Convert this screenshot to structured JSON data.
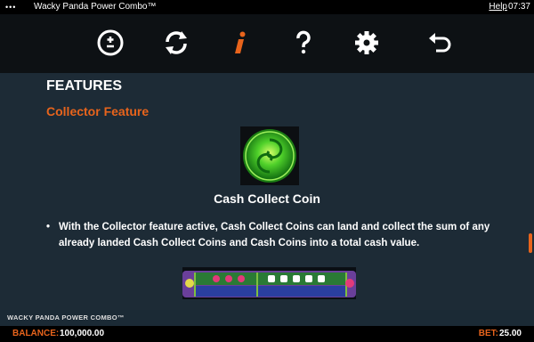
{
  "titlebar": {
    "dots": "•••",
    "title": "Wacky Panda Power Combo™",
    "help": "Help",
    "time": "07:37"
  },
  "toolbar": {
    "icons": [
      "plus-minus-icon",
      "autoplay-refresh-icon",
      "info-icon",
      "help-question-icon",
      "settings-gear-icon",
      "back-arrow-icon"
    ],
    "accent": "#e8641c"
  },
  "content": {
    "heading": "FEATURES",
    "subheading": "Collector Feature",
    "coin_caption": "Cash Collect Coin",
    "bullet": "With the Collector feature active, Cash Collect Coins can land and collect the sum of any already landed Cash Collect Coins and Cash Coins into a total cash value."
  },
  "footer": {
    "brand": "WACKY PANDA POWER COMBO™"
  },
  "statusbar": {
    "balance_label": "BALANCE:",
    "balance_value": "100,000.00",
    "bet_label": "BET:",
    "bet_value": "25.00"
  }
}
